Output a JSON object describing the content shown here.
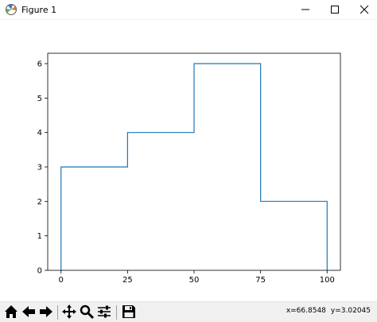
{
  "window": {
    "title": "Figure 1",
    "controls": [
      "minimize",
      "maximize",
      "close"
    ]
  },
  "toolbar": {
    "buttons": [
      "home",
      "back",
      "forward",
      "pan",
      "zoom",
      "configure-subplots",
      "save"
    ],
    "status_x": "x=66.8548",
    "status_y": "y=3.02045"
  },
  "chart_data": {
    "type": "line",
    "style": "step histogram (outline)",
    "bin_edges": [
      0,
      25,
      50,
      75,
      100
    ],
    "values": [
      3,
      4,
      6,
      2
    ],
    "xlim": [
      -5,
      105
    ],
    "ylim": [
      0,
      6.3
    ],
    "xticks": [
      0,
      25,
      50,
      75,
      100
    ],
    "yticks": [
      0,
      1,
      2,
      3,
      4,
      5,
      6
    ],
    "xlabel": "",
    "ylabel": "",
    "title": "",
    "grid": false,
    "line_color": "#1f77b4"
  }
}
